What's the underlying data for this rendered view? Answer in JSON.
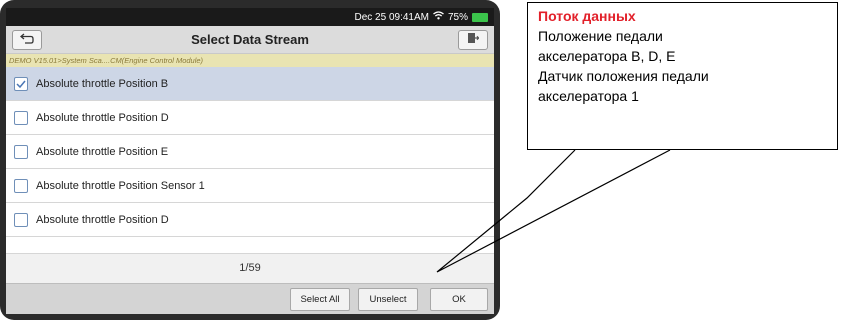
{
  "status_bar": {
    "time": "Dec 25 09:41AM",
    "battery": "75%",
    "battery_color": "#3bc44b"
  },
  "header": {
    "title": "Select Data Stream",
    "back_icon": "back-arrow-icon",
    "exit_icon": "exit-door-icon"
  },
  "breadcrumb": "DEMO V15.01>System Sca....CM(Engine Control Module)",
  "rows": [
    {
      "label": "Absolute throttle Position B",
      "checked": true
    },
    {
      "label": "Absolute throttle Position D",
      "checked": false
    },
    {
      "label": "Absolute throttle Position E",
      "checked": false
    },
    {
      "label": "Absolute throttle Position Sensor 1",
      "checked": false
    },
    {
      "label": "Absolute throttle Position D",
      "checked": false
    }
  ],
  "pagination": "1/59",
  "toolbar": {
    "select_all": "Select All",
    "unselect": "Unselect",
    "ok": "OK"
  },
  "callout": {
    "title": "Поток данных",
    "lines": [
      "Положение педали",
      "акселератора B, D, E",
      "Датчик положения педали",
      "акселератора 1"
    ],
    "title_color": "#e2202a"
  }
}
